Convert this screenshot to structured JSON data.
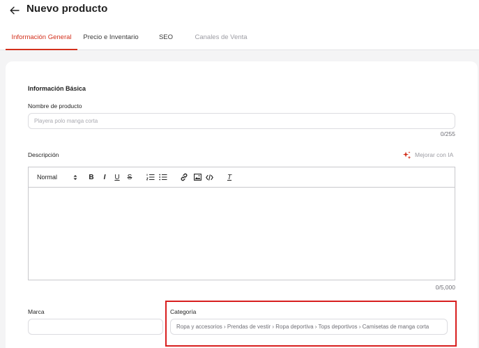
{
  "header": {
    "title": "Nuevo producto"
  },
  "tabs": [
    {
      "label": "Información General",
      "state": "active"
    },
    {
      "label": "Precio e Inventario",
      "state": "normal"
    },
    {
      "label": "SEO",
      "state": "normal"
    },
    {
      "label": "Canales de Venta",
      "state": "disabled"
    }
  ],
  "basic_info": {
    "section_title": "Información Básica",
    "name_label": "Nombre de producto",
    "name_placeholder": "Playera polo manga corta",
    "name_value": "",
    "name_counter": "0/255",
    "description_label": "Descripción",
    "ai_button_label": "Mejorar con IA",
    "description_counter": "0/5,000",
    "brand_label": "Marca",
    "brand_value": "",
    "category_label": "Categoría",
    "category_value": "Ropa y accesorios › Prendas de vestir › Ropa deportiva › Tops deportivos › Camisetas de manga corta"
  },
  "editor_toolbar": {
    "format_select_value": "Normal",
    "bold": "B",
    "italic": "I",
    "underline": "U",
    "strike": "S",
    "clear_format": "T"
  },
  "colors": {
    "accent": "#d3301c",
    "highlight": "#d81e1e"
  }
}
